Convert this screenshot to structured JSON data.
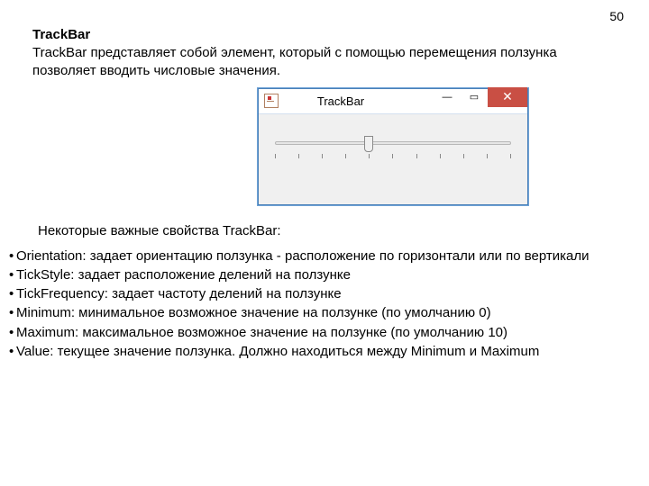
{
  "page_number": "50",
  "heading": "TrackBar",
  "intro": "TrackBar представляет собой элемент, который с помощью перемещения ползунка позволяет вводить числовые значения.",
  "window": {
    "title": "TrackBar",
    "close_glyph": "✕",
    "max_glyph": "▭",
    "min_glyph": "—",
    "trackbar_value": 4,
    "trackbar_min": 0,
    "trackbar_max": 10
  },
  "subheading": "Некоторые важные свойства TrackBar:",
  "properties": [
    "Orientation: задает ориентацию ползунка - расположение по горизонтали или по вертикали",
    "TickStyle: задает расположение делений на ползунке",
    "TickFrequency: задает частоту делений на ползунке",
    "Minimum: минимальное возможное значение на ползунке (по умолчанию 0)",
    "Maximum: максимальное возможное значение на ползунке (по умолчанию 10)",
    "Value: текущее значение ползунка. Должно находиться между Minimum и Maximum"
  ]
}
